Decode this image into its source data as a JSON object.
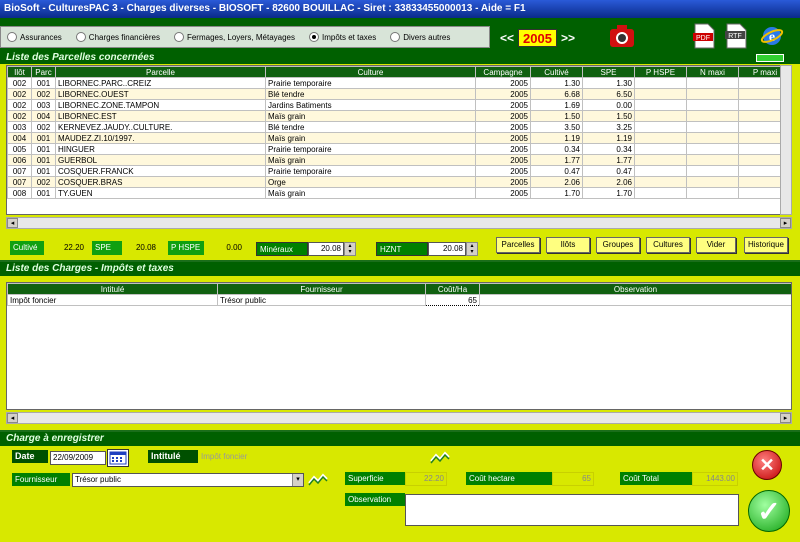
{
  "window": {
    "title": "BioSoft - CulturesPAC 3 - Charges diverses    - BIOSOFT - 82600 BOUILLAC - Siret : 33833455000013 - Aide = F1"
  },
  "tabs": [
    {
      "label": "Assurances",
      "selected": false
    },
    {
      "label": "Charges financières",
      "selected": false
    },
    {
      "label": "Fermages, Loyers, Métayages",
      "selected": false
    },
    {
      "label": "Impôts et taxes",
      "selected": true
    },
    {
      "label": "Divers autres",
      "selected": false
    }
  ],
  "year_nav": {
    "prev": "<<",
    "year": "2005",
    "next": ">>"
  },
  "parcelles": {
    "title": "Liste des Parcelles concernées",
    "columns": [
      "Ilôt",
      "Parc",
      "Parcelle",
      "Culture",
      "Campagne",
      "Cultivé",
      "SPE",
      "P HSPE",
      "N maxi",
      "P maxi"
    ],
    "rows": [
      [
        "002",
        "001",
        "LIBORNEC.PARC..CREIZ",
        "Prairie temporaire",
        "2005",
        "1.30",
        "1.30",
        "",
        "",
        ""
      ],
      [
        "002",
        "002",
        "LIBORNEC.OUEST",
        "Blé tendre",
        "2005",
        "6.68",
        "6.50",
        "",
        "",
        ""
      ],
      [
        "002",
        "003",
        "LIBORNEC.ZONE.TAMPON",
        "Jardins Batiments",
        "2005",
        "1.69",
        "0.00",
        "",
        "",
        ""
      ],
      [
        "002",
        "004",
        "LIBORNEC.EST",
        "Maïs grain",
        "2005",
        "1.50",
        "1.50",
        "",
        "",
        ""
      ],
      [
        "003",
        "002",
        "KERNEVEZ.JAUDY..CULTURE.",
        "Blé tendre",
        "2005",
        "3.50",
        "3.25",
        "",
        "",
        ""
      ],
      [
        "004",
        "001",
        "MAUDEZ.ZI.10/1997.",
        "Maïs grain",
        "2005",
        "1.19",
        "1.19",
        "",
        "",
        ""
      ],
      [
        "005",
        "001",
        "HINGUER",
        "Prairie temporaire",
        "2005",
        "0.34",
        "0.34",
        "",
        "",
        ""
      ],
      [
        "006",
        "001",
        "GUERBOL",
        "Maïs grain",
        "2005",
        "1.77",
        "1.77",
        "",
        "",
        ""
      ],
      [
        "007",
        "001",
        "COSQUER.FRANCK",
        "Prairie temporaire",
        "2005",
        "0.47",
        "0.47",
        "",
        "",
        ""
      ],
      [
        "007",
        "002",
        "COSQUER.BRAS",
        "Orge",
        "2005",
        "2.06",
        "2.06",
        "",
        "",
        ""
      ],
      [
        "008",
        "001",
        "TY.GUEN",
        "Maïs grain",
        "2005",
        "1.70",
        "1.70",
        "",
        "",
        ""
      ]
    ],
    "totals": {
      "cultive_label": "Cultivé",
      "cultive": "22.20",
      "spe_label": "SPE",
      "spe": "20.08",
      "phspe_label": "P HSPE",
      "phspe": "0.00",
      "mineraux_label": "Minéraux",
      "mineraux": "20.08",
      "hznt_label": "HZNT",
      "hznt": "20.08"
    },
    "buttons": [
      "Parcelles",
      "Ilôts",
      "Groupes",
      "Cultures",
      "Vider",
      "Historique"
    ]
  },
  "charges": {
    "title": "Liste des Charges - Impôts et taxes",
    "columns": [
      "Intitulé",
      "Fournisseur",
      "Coût/Ha",
      "Observation"
    ],
    "rows": [
      [
        "Impôt foncier",
        "Trésor public",
        "65",
        ""
      ]
    ]
  },
  "form": {
    "title": "Charge à enregistrer",
    "date_label": "Date",
    "date_value": "22/09/2009",
    "intitule_label": "Intitulé",
    "intitule_value": "Impôt foncier",
    "fournisseur_label": "Fournisseur",
    "fournisseur_value": "Trésor public",
    "superficie_label": "Superficie",
    "superficie_value": "22.20",
    "cout_hectare_label": "Coût hectare",
    "cout_hectare_value": "65",
    "cout_total_label": "Coût Total",
    "cout_total_value": "1443.00",
    "observation_label": "Observation",
    "observation_value": ""
  },
  "icons": {
    "pdf": "PDF",
    "rtf": "RTF"
  },
  "colors": {
    "panel": "#d8e800",
    "header": "#106010",
    "frame": "#006000",
    "accent_red": "#e00000"
  }
}
